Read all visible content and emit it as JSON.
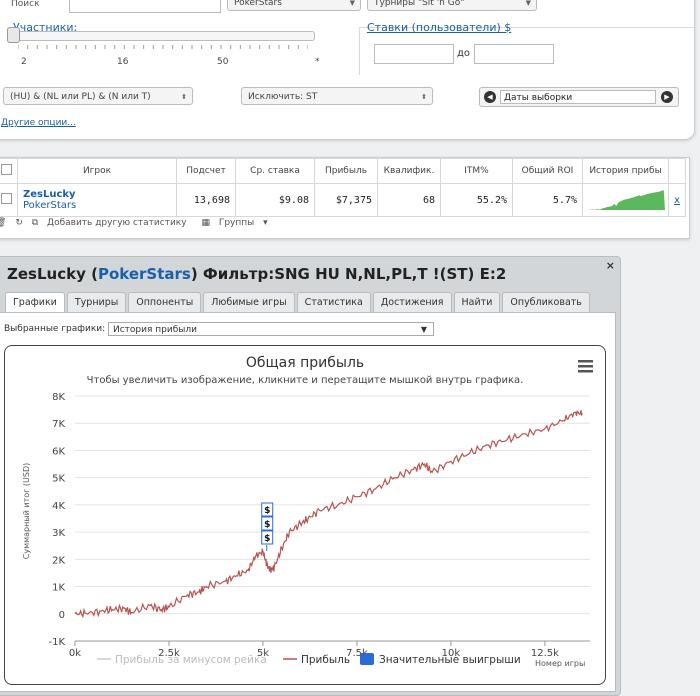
{
  "filters": {
    "search_label": "Поиск",
    "site_select": "PokerStars",
    "tournament_select": "Турниры \"Sit 'n Go\"",
    "participants_label": "Участники:",
    "participants_ticks": [
      "2",
      "16",
      "50",
      "*"
    ],
    "stakes_label": "Ставки (пользователи) $",
    "stakes_to": "до",
    "formula_select": "(HU) & (NL или PL) & (N или T)",
    "exclude_select": "Исключить: ST",
    "date_range_label": "Даты выборки",
    "more_options": "Другие опции..."
  },
  "stats_table": {
    "columns": [
      "Игрок",
      "Подсчет",
      "Ср. ставка",
      "Прибыль",
      "Квалифик.",
      "ITM%",
      "Общий ROI",
      "История прибы"
    ],
    "rows": [
      {
        "player": "ZesLucky",
        "site": "PokerStars",
        "count": "13,698",
        "avg_stake": "$9.08",
        "profit": "$7,375",
        "qual": "68",
        "itm": "55.2%",
        "roi": "5.7%",
        "remove": "x"
      }
    ],
    "toolbar": {
      "add_stat": "Добавить другую статистику",
      "groups": "Группы"
    }
  },
  "player_window": {
    "player": "ZesLucky",
    "site": "PokerStars",
    "filter_text": "Фильтр:SNG HU N,NL,PL,T !(ST) E:2",
    "close": "×",
    "tabs": [
      "Графики",
      "Турниры",
      "Оппоненты",
      "Любимые игры",
      "Статистика",
      "Достижения",
      "Найти",
      "Опубликовать"
    ],
    "active_tab": "Графики",
    "graph_select_label": "Выбранные графики:",
    "graph_select_value": "История прибыли"
  },
  "chart_data": {
    "type": "line",
    "title": "Общая прибыль",
    "subtitle": "Чтобы увеличить изображение, кликните и перетащите мышкой внутрь графика.",
    "xlabel": "Номер игры",
    "ylabel": "Суммарный итог (USD)",
    "xlim": [
      0,
      13700
    ],
    "ylim": [
      -1000,
      8000
    ],
    "x_ticks": [
      "0k",
      "2.5k",
      "5k",
      "7.5k",
      "10k",
      "12.5k"
    ],
    "y_ticks": [
      "-1K",
      "0",
      "1K",
      "2K",
      "3K",
      "4K",
      "5K",
      "6K",
      "7K",
      "8K"
    ],
    "grid": true,
    "legend_position": "bottom",
    "series": [
      {
        "name": "Прибыль за минусом рейка",
        "color": "#cccccc",
        "values": []
      },
      {
        "name": "Прибыль",
        "color": "#b85450",
        "x": [
          0,
          300,
          700,
          1000,
          1300,
          1500,
          2000,
          2300,
          2500,
          3000,
          3300,
          3500,
          4000,
          4300,
          4600,
          4800,
          5000,
          5100,
          5200,
          5300,
          5500,
          5700,
          6000,
          6200,
          6500,
          7000,
          7500,
          8000,
          8500,
          9000,
          9300,
          9500,
          10000,
          10500,
          11000,
          11500,
          12000,
          12500,
          13000,
          13300,
          13500
        ],
        "y": [
          0,
          10,
          100,
          150,
          200,
          50,
          300,
          150,
          250,
          700,
          800,
          1000,
          1200,
          1400,
          1600,
          2100,
          2300,
          1800,
          1600,
          1700,
          2400,
          3000,
          3300,
          3500,
          3800,
          4000,
          4300,
          4600,
          5000,
          5300,
          5500,
          5200,
          5600,
          5900,
          6200,
          6400,
          6600,
          6800,
          7100,
          7400,
          7350
        ]
      }
    ],
    "flags": {
      "name": "Значительные выигрыши",
      "color": "#2b6bd6",
      "labels": [
        "$",
        "$",
        "$"
      ],
      "x": 5100
    }
  },
  "sparkline_color": "#5cb85c"
}
